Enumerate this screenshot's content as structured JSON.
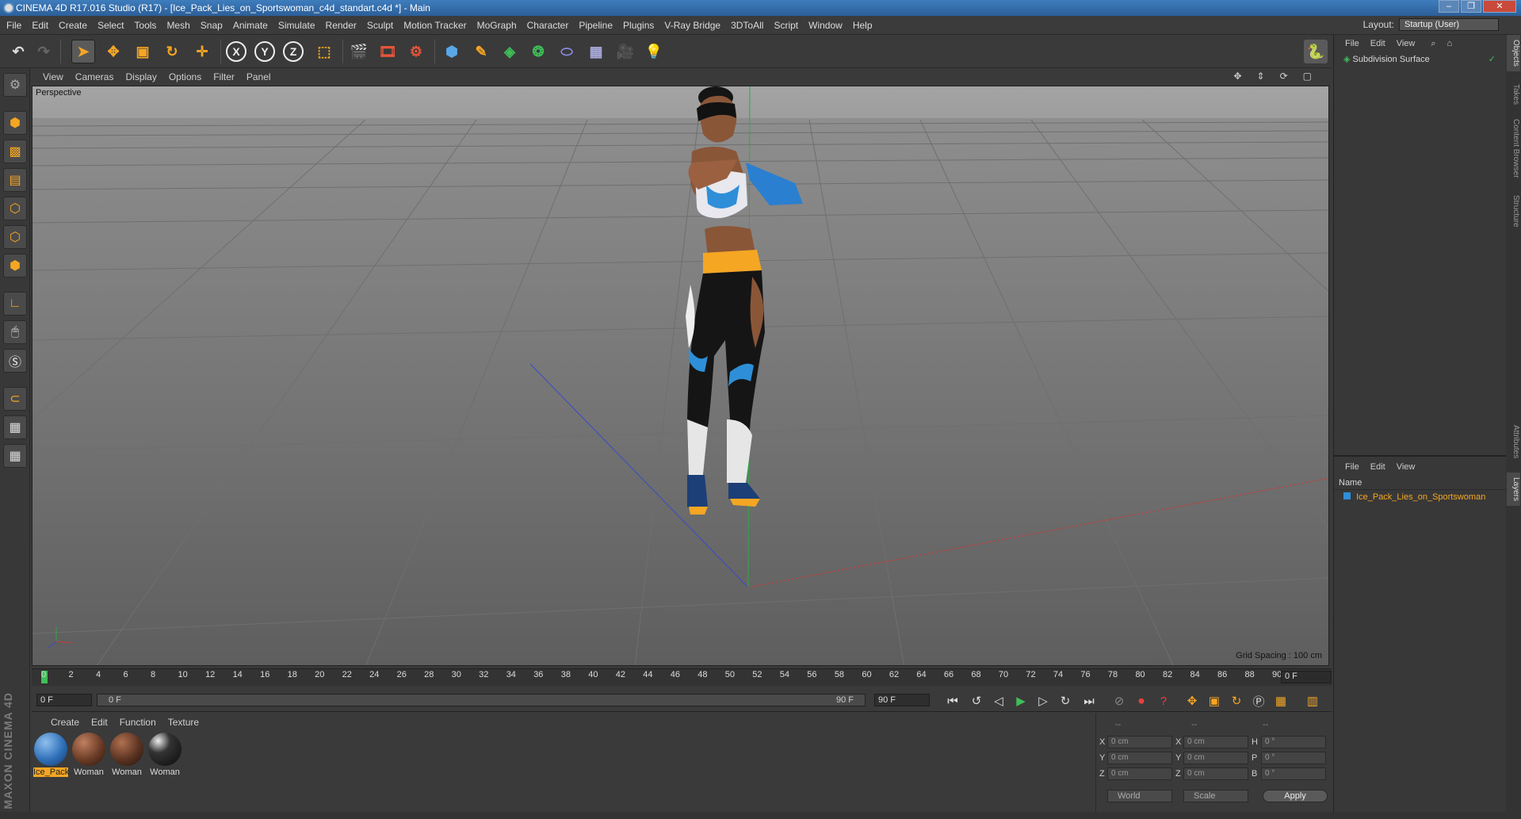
{
  "window": {
    "title": "CINEMA 4D R17.016 Studio (R17) - [Ice_Pack_Lies_on_Sportswoman_c4d_standart.c4d *] - Main"
  },
  "menu": [
    "File",
    "Edit",
    "Create",
    "Select",
    "Tools",
    "Mesh",
    "Snap",
    "Animate",
    "Simulate",
    "Render",
    "Sculpt",
    "Motion Tracker",
    "MoGraph",
    "Character",
    "Pipeline",
    "Plugins",
    "V-Ray Bridge",
    "3DToAll",
    "Script",
    "Window",
    "Help"
  ],
  "layout": {
    "label": "Layout:",
    "value": "Startup (User)"
  },
  "viewport": {
    "menu": [
      "View",
      "Cameras",
      "Display",
      "Options",
      "Filter",
      "Panel"
    ],
    "label": "Perspective",
    "grid_spacing": "Grid Spacing : 100 cm"
  },
  "timeline": {
    "ticks": [
      "0",
      "2",
      "4",
      "6",
      "8",
      "10",
      "12",
      "14",
      "16",
      "18",
      "20",
      "22",
      "24",
      "26",
      "28",
      "30",
      "32",
      "34",
      "36",
      "38",
      "40",
      "42",
      "44",
      "46",
      "48",
      "50",
      "52",
      "54",
      "56",
      "58",
      "60",
      "62",
      "64",
      "66",
      "68",
      "70",
      "72",
      "74",
      "76",
      "78",
      "80",
      "82",
      "84",
      "86",
      "88",
      "90"
    ],
    "current_frame": "0 F"
  },
  "transport": {
    "start": "0 F",
    "slider_left": "0 F",
    "slider_right": "90 F",
    "end": "90 F"
  },
  "materials": {
    "menu": [
      "Create",
      "Edit",
      "Function",
      "Texture"
    ],
    "items": [
      {
        "label": "Ice_Pack",
        "selected": true,
        "color": "#2f6fb8"
      },
      {
        "label": "Woman",
        "selected": false,
        "color": "#6a3b26"
      },
      {
        "label": "Woman",
        "selected": false,
        "color": "#5a3322"
      },
      {
        "label": "Woman",
        "selected": false,
        "color": "#1a1a1a"
      }
    ]
  },
  "coords": {
    "header": [
      "--",
      "--",
      "--"
    ],
    "rows": [
      {
        "a": "X",
        "av": "0 cm",
        "b": "X",
        "bv": "0 cm",
        "c": "H",
        "cv": "0 °"
      },
      {
        "a": "Y",
        "av": "0 cm",
        "b": "Y",
        "bv": "0 cm",
        "c": "P",
        "cv": "0 °"
      },
      {
        "a": "Z",
        "av": "0 cm",
        "b": "Z",
        "bv": "0 cm",
        "c": "B",
        "cv": "0 °"
      }
    ],
    "world": "World",
    "scale": "Scale",
    "apply": "Apply"
  },
  "objects": {
    "menu": [
      "File",
      "Edit",
      "View"
    ],
    "items": [
      "Subdivision Surface"
    ]
  },
  "layers": {
    "menu": [
      "File",
      "Edit",
      "View"
    ],
    "column": "Name",
    "items": [
      "Ice_Pack_Lies_on_Sportswoman"
    ]
  },
  "side_tabs": [
    "Objects",
    "Takes",
    "Content Browser",
    "Structure",
    "Attributes",
    "Layers"
  ],
  "brand": "MAXON CINEMA 4D",
  "colors": {
    "accent": "#f5a623",
    "layer_text": "#f5a623",
    "x_axis": "#c83a3a",
    "y_axis": "#2fa84a",
    "z_axis": "#3a4ac8"
  }
}
